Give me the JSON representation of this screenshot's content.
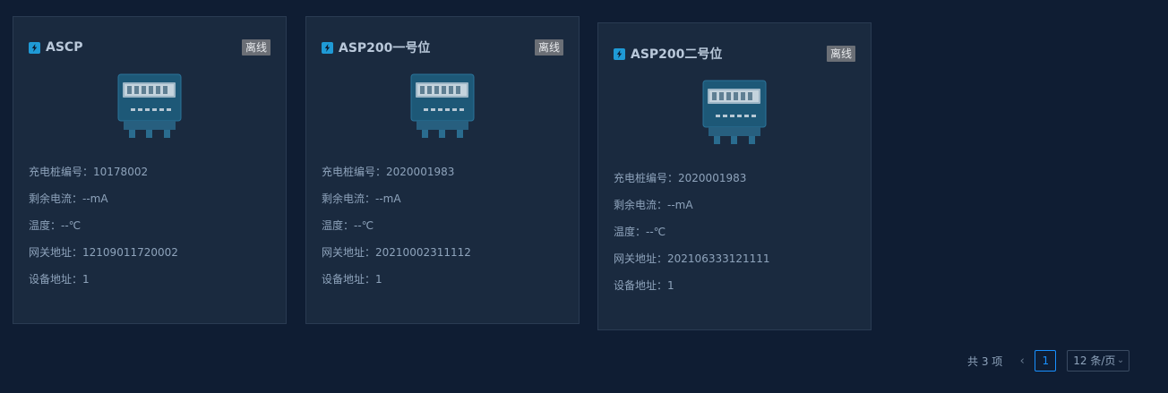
{
  "status_offline": "离线",
  "labels": {
    "pile_no": "充电桩编号：",
    "residual_current": "剩余电流：",
    "temperature": "温度：",
    "gateway_addr": "网关地址：",
    "device_addr": "设备地址："
  },
  "cards": [
    {
      "title": "ASCP",
      "status": "离线",
      "pile_no": "10178002",
      "residual_current": "--mA",
      "temperature": "--℃",
      "gateway_addr": "12109011720002",
      "device_addr": "1"
    },
    {
      "title": "ASP200一号位",
      "status": "离线",
      "pile_no": "2020001983",
      "residual_current": "--mA",
      "temperature": "--℃",
      "gateway_addr": "20210002311112",
      "device_addr": "1"
    },
    {
      "title": "ASP200二号位",
      "status": "离线",
      "pile_no": "2020001983",
      "residual_current": "--mA",
      "temperature": "--℃",
      "gateway_addr": "202106333121111",
      "device_addr": "1"
    }
  ],
  "pagination": {
    "total_text": "共 3 项",
    "current_page": "1",
    "page_size": "12 条/页"
  },
  "colors": {
    "background": "#0f1d33",
    "card": "#1a2a3f",
    "accent": "#1890ff",
    "badge": "#6b6f76"
  }
}
